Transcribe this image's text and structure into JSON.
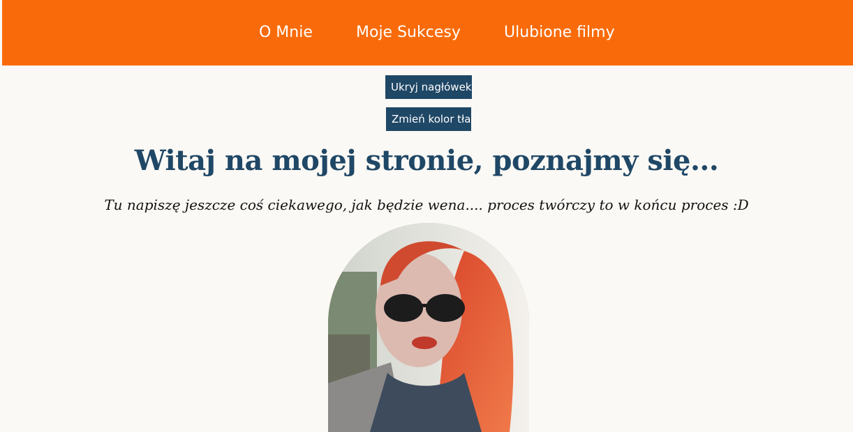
{
  "nav": {
    "items": [
      {
        "label": "O Mnie"
      },
      {
        "label": "Moje Sukcesy"
      },
      {
        "label": "Ulubione filmy"
      }
    ]
  },
  "controls": {
    "hide_header_label": "Ukryj nagłówek",
    "change_bg_label": "Zmień kolor tła"
  },
  "main": {
    "title": "Witaj na mojej stronie, poznajmy się...",
    "subtitle": "Tu napiszę jeszcze coś ciekawego, jak będzie wena.... proces twórczy to w końcu proces :D"
  },
  "colors": {
    "header_bg": "#f96b0a",
    "accent": "#1f4766",
    "page_bg": "#fbf9f5"
  }
}
